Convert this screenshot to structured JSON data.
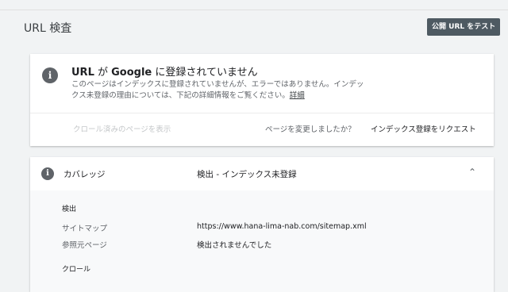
{
  "header": {
    "title": "URL 検査",
    "test_button": "公開 URL をテスト"
  },
  "status_card": {
    "title_prefix": "URL",
    "title_mid1": " が ",
    "title_brand": "Google",
    "title_suffix": " に登録されていません",
    "description": "このページはインデックスに登録されていませんが、エラーではありません。インデックス未登録の理由については、下記の詳細情報をご覧ください。",
    "details_link": "詳細",
    "view_crawled": "クロール済みのページを表示",
    "page_changed": "ページを変更しましたか？",
    "request_indexing": "インデックス登録をリクエスト"
  },
  "coverage": {
    "label": "カバレッジ",
    "status": "検出 - インデックス未登録",
    "sections": {
      "discovery": "検出",
      "crawl": "クロール"
    },
    "rows": [
      {
        "label": "サイトマップ",
        "value": "https://www.hana-lima-nab.com/sitemap.xml"
      },
      {
        "label": "参照元ページ",
        "value": "検出されませんでした"
      }
    ]
  },
  "colors": {
    "background": "#f1f3f4",
    "button": "#4e5a62",
    "info_icon": "#5f6368"
  }
}
